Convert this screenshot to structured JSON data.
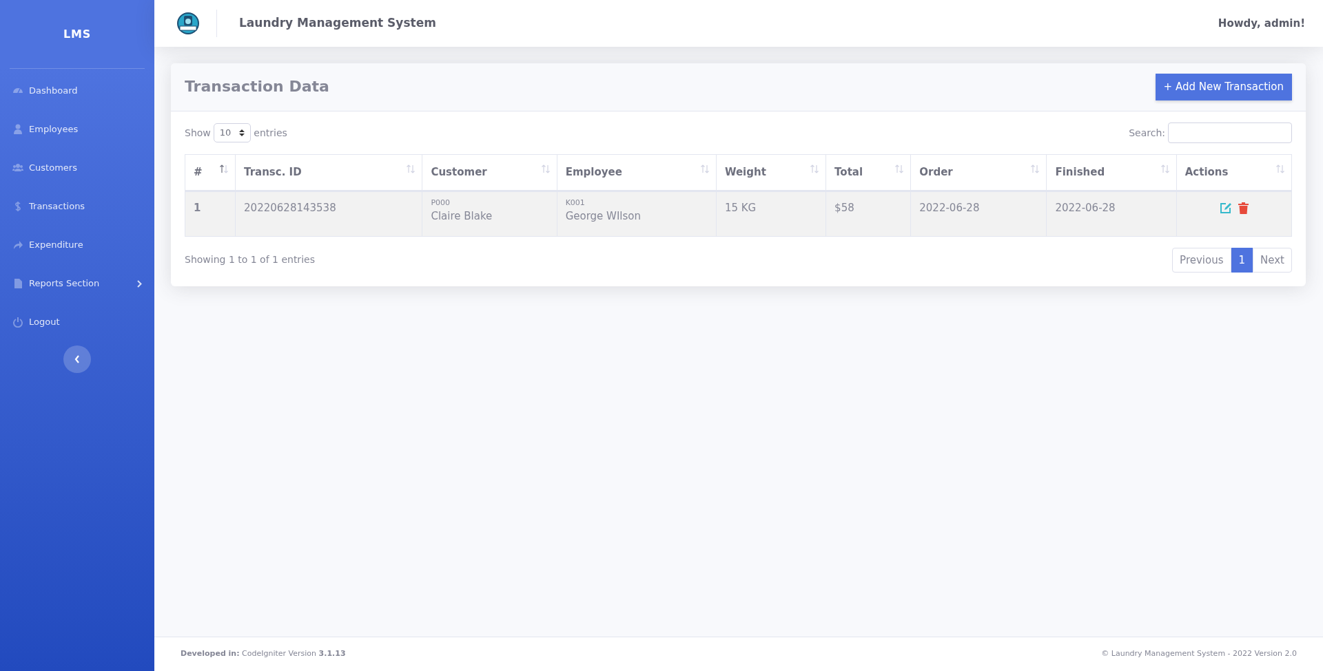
{
  "sidebar": {
    "brand": "LMS",
    "items": [
      {
        "label": "Dashboard",
        "kind": "link"
      },
      {
        "label": "Employees",
        "kind": "link"
      },
      {
        "label": "Customers",
        "kind": "link"
      },
      {
        "label": "Transactions",
        "kind": "link"
      },
      {
        "label": "Expenditure",
        "kind": "link"
      },
      {
        "label": "Reports Section",
        "kind": "submenu"
      },
      {
        "label": "Logout",
        "kind": "link"
      }
    ]
  },
  "topbar": {
    "title": "Laundry Management System",
    "greeting": "Howdy, admin!"
  },
  "card": {
    "title": "Transaction Data",
    "add_button": "+ Add New Transaction",
    "length": {
      "before": "Show",
      "value": "10",
      "after": "entries"
    },
    "search": {
      "label": "Search:"
    },
    "table": {
      "columns": [
        {
          "label": "#",
          "sorted": true
        },
        {
          "label": "Transc. ID",
          "sorted": false
        },
        {
          "label": "Customer",
          "sorted": false
        },
        {
          "label": "Employee",
          "sorted": false
        },
        {
          "label": "Weight",
          "sorted": false
        },
        {
          "label": "Total",
          "sorted": false
        },
        {
          "label": "Order",
          "sorted": false
        },
        {
          "label": "Finished",
          "sorted": false
        },
        {
          "label": "Actions",
          "sorted": false
        }
      ],
      "rows": [
        {
          "no": "1",
          "id": "20220628143538",
          "customer_code": "P000",
          "customer": "Claire Blake",
          "employee_code": "K001",
          "employee": "George WIlson",
          "weight": "15 KG",
          "total": "$58",
          "order": "2022-06-28",
          "finished": "2022-06-28"
        }
      ]
    },
    "info": "Showing 1 to 1 of 1 entries",
    "pagination": [
      {
        "label": "Previous",
        "selected": false
      },
      {
        "label": "1",
        "selected": true
      },
      {
        "label": "Next",
        "selected": false
      }
    ]
  },
  "footer": {
    "left": "**Developed in:** CodeIgniter Version **3.1.13**",
    "right": "© Laundry Management System - 2022 Version 2.0"
  }
}
